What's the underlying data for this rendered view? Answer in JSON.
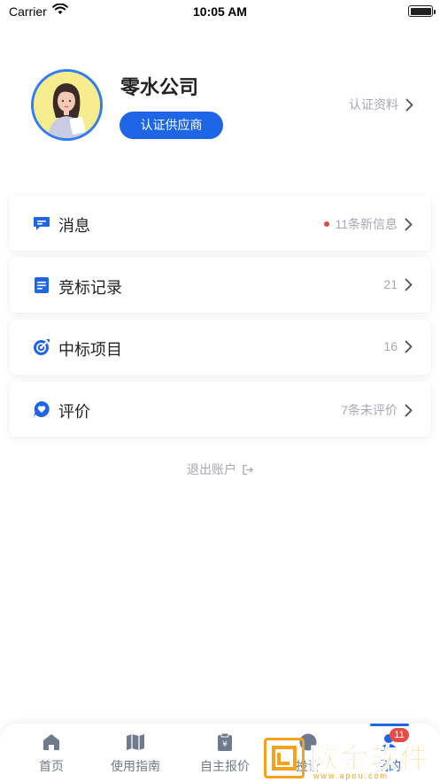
{
  "status_bar": {
    "carrier": "Carrier",
    "time": "10:05 AM"
  },
  "profile": {
    "company_name": "零水公司",
    "verify_button": "认证供应商",
    "cert_link": "认证资料"
  },
  "menu": [
    {
      "label": "消息",
      "value": "11条新信息",
      "icon": "message-icon"
    },
    {
      "label": "竞标记录",
      "value": "21",
      "icon": "document-icon"
    },
    {
      "label": "中标项目",
      "value": "16",
      "icon": "target-icon"
    },
    {
      "label": "评价",
      "value": "7条未评价",
      "icon": "heart-icon"
    }
  ],
  "logout_label": "退出账户",
  "tabbar": {
    "tabs": [
      {
        "label": "首页",
        "icon": "home-icon"
      },
      {
        "label": "使用指南",
        "icon": "map-icon"
      },
      {
        "label": "自主报价",
        "icon": "quote-clipboard-icon"
      },
      {
        "label": "投诉",
        "icon": "complaint-icon"
      },
      {
        "label": "我的",
        "icon": "user-icon",
        "active": true
      }
    ],
    "badge": "11"
  },
  "watermark": {
    "text": "欧金软件园",
    "sub": "www.apou.com"
  },
  "colors": {
    "accent": "#1f66e6",
    "muted_text": "#a5a8b0",
    "badge": "#ea4b47",
    "watermark": "#f6a21a"
  }
}
